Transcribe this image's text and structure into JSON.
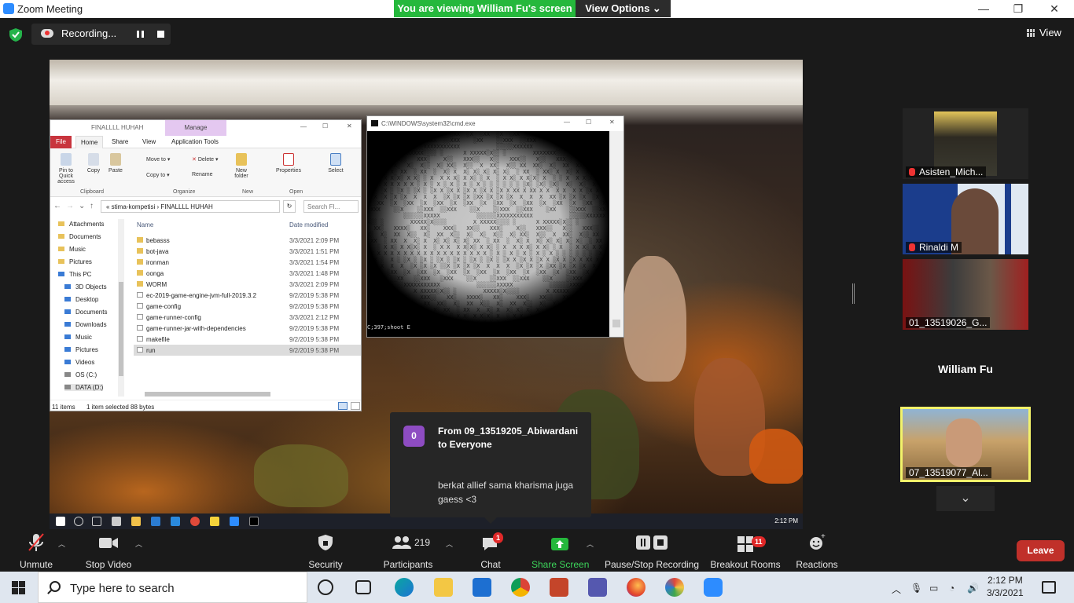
{
  "window": {
    "title": "Zoom Meeting"
  },
  "banner": {
    "viewing": "You are viewing William Fu's screen",
    "view_options": "View Options"
  },
  "recording": {
    "label": "Recording..."
  },
  "view_button": {
    "label": "View"
  },
  "explorer": {
    "title": "FINALLLL HUHAH",
    "manage_tab": "Manage",
    "tabs": [
      "File",
      "Home",
      "Share",
      "View",
      "Application Tools"
    ],
    "ribbon": {
      "pin": "Pin to Quick access",
      "copy": "Copy",
      "paste": "Paste",
      "move_to": "Move to",
      "copy_to": "Copy to",
      "delete": "Delete",
      "rename": "Rename",
      "new_folder": "New folder",
      "properties": "Properties",
      "select": "Select",
      "groups": [
        "Clipboard",
        "Organize",
        "New",
        "Open"
      ]
    },
    "address": {
      "parts": "«  stima-kompetisi  ›  FINALLLL HUHAH",
      "search_placeholder": "Search FI..."
    },
    "nav_items": [
      "Attachments",
      "Documents",
      "Music",
      "Pictures",
      "This PC",
      "3D Objects",
      "Desktop",
      "Documents",
      "Downloads",
      "Music",
      "Pictures",
      "Videos",
      "OS (C:)",
      "DATA (D:)"
    ],
    "columns": {
      "name": "Name",
      "date": "Date modified"
    },
    "files": [
      {
        "name": "bebasss",
        "date": "3/3/2021 2:09 PM"
      },
      {
        "name": "bot-java",
        "date": "3/3/2021 1:51 PM"
      },
      {
        "name": "ironman",
        "date": "3/3/2021 1:54 PM"
      },
      {
        "name": "oonga",
        "date": "3/3/2021 1:48 PM"
      },
      {
        "name": "WORM",
        "date": "3/3/2021 2:09 PM"
      },
      {
        "name": "ec-2019-game-engine-jvm-full-2019.3.2",
        "date": "9/2/2019 5:38 PM"
      },
      {
        "name": "game-config",
        "date": "9/2/2019 5:38 PM"
      },
      {
        "name": "game-runner-config",
        "date": "3/3/2021 2:12 PM"
      },
      {
        "name": "game-runner-jar-with-dependencies",
        "date": "9/2/2019 5:38 PM"
      },
      {
        "name": "makefile",
        "date": "9/2/2019 5:38 PM"
      },
      {
        "name": "run",
        "date": "9/2/2019 5:38 PM"
      }
    ],
    "status": {
      "count": "11 items",
      "selected": "1 item selected  88 bytes"
    }
  },
  "cmd": {
    "title": "C:\\WINDOWS\\system32\\cmd.exe",
    "prompt": "C;397;shoot E"
  },
  "inner_taskbar": {
    "clock": "2:12 PM"
  },
  "participants": [
    {
      "name": "Asisten_Mich...",
      "muted": true
    },
    {
      "name": "Rinaldi M",
      "muted": true
    },
    {
      "name": "01_13519026_G...",
      "muted": false
    },
    {
      "name": "William Fu",
      "muted": false
    },
    {
      "name": "07_13519077_Al...",
      "muted": false
    }
  ],
  "chat": {
    "avatar": "0",
    "from": "From 09_13519205_Abiwardani to Everyone",
    "message": "berkat allief sama kharisma juga gaess <3"
  },
  "toolbar": {
    "unmute": "Unmute",
    "stop_video": "Stop Video",
    "security": "Security",
    "participants": "Participants",
    "participants_count": "219",
    "chat": "Chat",
    "chat_badge": "1",
    "share_screen": "Share Screen",
    "recording": "Pause/Stop Recording",
    "breakout": "Breakout Rooms",
    "breakout_badge": "11",
    "reactions": "Reactions",
    "leave": "Leave"
  },
  "taskbar": {
    "search_placeholder": "Type here to search",
    "time": "2:12 PM",
    "date": "3/3/2021"
  },
  "colors": {
    "zoom_blue": "#2d8cff",
    "green": "#25b83c",
    "leave_red": "#c0302a",
    "active_border": "#f3f36a"
  }
}
